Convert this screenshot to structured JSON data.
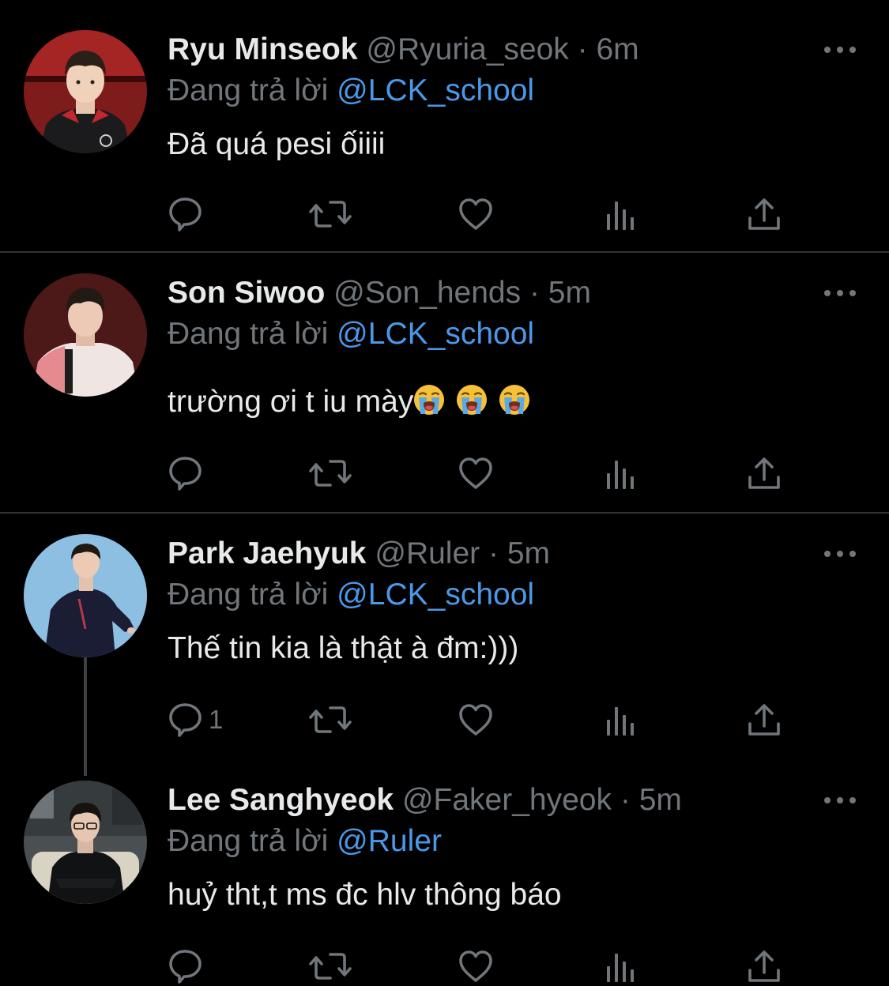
{
  "colors": {
    "background": "#000000",
    "name": "#e7e9ea",
    "muted": "#71767b",
    "link": "#4a99e9",
    "divider": "#2f3336"
  },
  "tweets": [
    {
      "name": "Ryu Minseok",
      "handle": "@Ryuria_seok",
      "separator": "·",
      "time": "6m",
      "reply_prefix": "Đang trả lời",
      "reply_to": "@LCK_school",
      "text": "Đã quá pesi ốiiii",
      "reply_count": ""
    },
    {
      "name": "Son Siwoo",
      "handle": "@Son_hends",
      "separator": "·",
      "time": "5m",
      "reply_prefix": "Đang trả lời",
      "reply_to": "@LCK_school",
      "text": "trường ơi t iu mày",
      "emojis": [
        "loudly-crying-face",
        "loudly-crying-face",
        "loudly-crying-face"
      ],
      "reply_count": ""
    },
    {
      "name": "Park Jaehyuk",
      "handle": "@Ruler",
      "separator": "·",
      "time": "5m",
      "reply_prefix": "Đang trả lời",
      "reply_to": "@LCK_school",
      "text": "Thế tin kia là thật à đm:)))",
      "reply_count": "1"
    },
    {
      "name": "Lee Sanghyeok",
      "handle": "@Faker_hyeok",
      "separator": "·",
      "time": "5m",
      "reply_prefix": "Đang trả lời",
      "reply_to": "@Ruler",
      "text": "huỷ tht,t ms đc hlv thông báo",
      "reply_count": ""
    }
  ],
  "icons": {
    "reply": "reply-icon",
    "retweet": "retweet-icon",
    "like": "heart-icon",
    "views": "views-icon",
    "share": "share-icon",
    "more": "more-icon"
  }
}
